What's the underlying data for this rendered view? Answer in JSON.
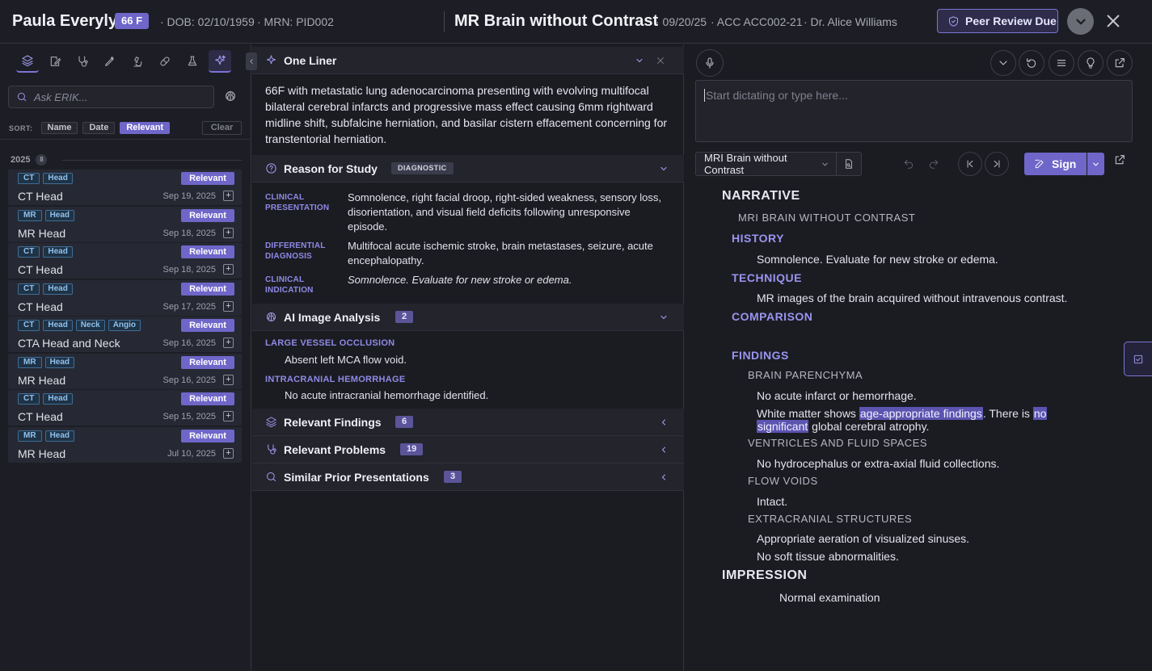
{
  "header": {
    "patient_name": "Paula Everyly",
    "age_sex": "66 F",
    "dob": "· DOB: 02/10/1959",
    "mrn": "· MRN: PID002",
    "study_title": "MR Brain without Contrast",
    "study_date": "· 09/20/25",
    "accession": "· ACC ACC002-21",
    "physician": "· Dr. Alice Williams",
    "peer_review": "Peer Review Due"
  },
  "left": {
    "search_placeholder": "Ask ERIK...",
    "sort_label": "SORT:",
    "sort_options": [
      "Name",
      "Date",
      "Relevant"
    ],
    "sort_active": "Relevant",
    "clear": "Clear",
    "year": "2025",
    "year_count": "8",
    "studies": [
      {
        "tags": [
          "CT",
          "Head"
        ],
        "badge": "Relevant",
        "name": "CT Head",
        "date": "Sep 19, 2025"
      },
      {
        "tags": [
          "MR",
          "Head"
        ],
        "badge": "Relevant",
        "name": "MR Head",
        "date": "Sep 18, 2025"
      },
      {
        "tags": [
          "CT",
          "Head"
        ],
        "badge": "Relevant",
        "name": "CT Head",
        "date": "Sep 18, 2025"
      },
      {
        "tags": [
          "CT",
          "Head"
        ],
        "badge": "Relevant",
        "name": "CT Head",
        "date": "Sep 17, 2025"
      },
      {
        "tags": [
          "CT",
          "Head",
          "Neck",
          "Angio"
        ],
        "badge": "Relevant",
        "name": "CTA Head and Neck",
        "date": "Sep 16, 2025"
      },
      {
        "tags": [
          "MR",
          "Head"
        ],
        "badge": "Relevant",
        "name": "MR Head",
        "date": "Sep 16, 2025"
      },
      {
        "tags": [
          "CT",
          "Head"
        ],
        "badge": "Relevant",
        "name": "CT Head",
        "date": "Sep 15, 2025"
      },
      {
        "tags": [
          "MR",
          "Head"
        ],
        "badge": "Relevant",
        "name": "MR Head",
        "date": "Jul 10, 2025"
      }
    ]
  },
  "middle": {
    "one_liner_title": "One Liner",
    "one_liner_text": "66F with metastatic lung adenocarcinoma presenting with evolving multifocal bilateral cerebral infarcts and progressive mass effect causing 6mm rightward midline shift, subfalcine herniation, and basilar cistern effacement concerning for transtentorial herniation.",
    "reason_title": "Reason for Study",
    "reason_badge": "DIAGNOSTIC",
    "reason_rows": [
      {
        "label": "CLINICAL PRESENTATION",
        "value": "Somnolence, right facial droop, right-sided weakness, sensory loss, disorientation, and visual field deficits following unresponsive episode."
      },
      {
        "label": "DIFFERENTIAL DIAGNOSIS",
        "value": "Multifocal acute ischemic stroke, brain metastases, seizure, acute encephalopathy."
      },
      {
        "label": "CLINICAL INDICATION",
        "value": "Somnolence. Evaluate for new stroke or edema."
      }
    ],
    "ai_title": "AI Image Analysis",
    "ai_count": "2",
    "ai_items": [
      {
        "label": "LARGE VESSEL OCCLUSION",
        "value": "Absent left MCA flow void."
      },
      {
        "label": "INTRACRANIAL HEMORRHAGE",
        "value": "No acute intracranial hemorrhage identified."
      }
    ],
    "findings_title": "Relevant Findings",
    "findings_count": "6",
    "problems_title": "Relevant Problems",
    "problems_count": "19",
    "similar_title": "Similar Prior Presentations",
    "similar_count": "3"
  },
  "right": {
    "dictation_placeholder": "Start dictating or type here...",
    "template": "MRI Brain without Contrast",
    "sign": "Sign",
    "report": {
      "narrative": "NARRATIVE",
      "exam": "MRI BRAIN WITHOUT CONTRAST",
      "history_h": "HISTORY",
      "history": "Somnolence. Evaluate for new stroke or edema.",
      "technique_h": "TECHNIQUE",
      "technique": "MR images of the brain acquired without intravenous contrast.",
      "comparison_h": "COMPARISON",
      "findings_h": "FINDINGS",
      "parenchyma_h": "BRAIN PARENCHYMA",
      "parenchyma_1": "No acute infarct or hemorrhage.",
      "parenchyma_2a": "White matter shows",
      "parenchyma_2b": "age-appropriate findings",
      "parenchyma_2c": ". There is",
      "parenchyma_2d": "no",
      "parenchyma_2e": "significant",
      "parenchyma_2f": "global cerebral atrophy.",
      "ventricles_h": "VENTRICLES AND FLUID SPACES",
      "ventricles": "No hydrocephalus or extra-axial fluid collections.",
      "flow_h": "FLOW VOIDS",
      "flow": "Intact.",
      "extra_h": "EXTRACRANIAL STRUCTURES",
      "extra_1": "Appropriate aeration of visualized sinuses.",
      "extra_2": "No soft tissue abnormalities.",
      "impression_h": "IMPRESSION",
      "impression": "Normal examination"
    }
  }
}
